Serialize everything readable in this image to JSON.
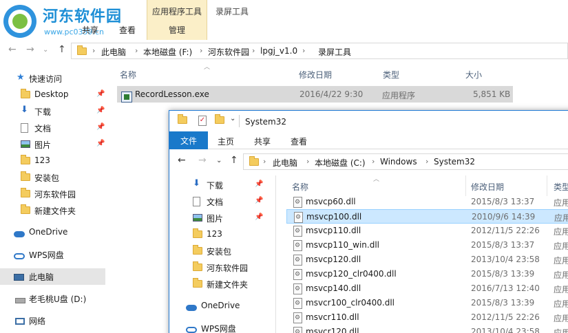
{
  "window1": {
    "watermark": {
      "brand": "河东软件园",
      "url": "www.pc0359.cn"
    },
    "context_tab_label": "应用程序工具",
    "context_subtab": "管理",
    "title": "录屏工具",
    "ribbon_tabs": [
      "共享",
      "查看"
    ],
    "breadcrumb": [
      "此电脑",
      "本地磁盘 (F:)",
      "河东软件园",
      "lpgj_v1.0",
      "录屏工具"
    ],
    "columns": [
      "名称",
      "修改日期",
      "类型",
      "大小"
    ],
    "nav": [
      {
        "label": "快速访问",
        "icon": "star-icon",
        "pinned": false
      },
      {
        "label": "Desktop",
        "icon": "folder-icon",
        "pinned": true
      },
      {
        "label": "下载",
        "icon": "download-icon",
        "pinned": true
      },
      {
        "label": "文档",
        "icon": "document-icon",
        "pinned": true
      },
      {
        "label": "图片",
        "icon": "picture-icon",
        "pinned": true
      },
      {
        "label": "123",
        "icon": "folder-icon",
        "pinned": false
      },
      {
        "label": "安装包",
        "icon": "folder-icon",
        "pinned": false
      },
      {
        "label": "河东软件园",
        "icon": "folder-icon",
        "pinned": false
      },
      {
        "label": "新建文件夹",
        "icon": "folder-icon",
        "pinned": false
      },
      {
        "label": "OneDrive",
        "icon": "onedrive-icon",
        "pinned": false
      },
      {
        "label": "WPS网盘",
        "icon": "wps-cloud-icon",
        "pinned": false
      },
      {
        "label": "此电脑",
        "icon": "this-pc-icon",
        "pinned": false,
        "selected": true
      },
      {
        "label": "老毛桃U盘 (D:)",
        "icon": "usb-drive-icon",
        "pinned": false
      },
      {
        "label": "网络",
        "icon": "network-icon",
        "pinned": false
      }
    ],
    "file": {
      "name": "RecordLesson.exe",
      "date": "2016/4/22 9:30",
      "type": "应用程序",
      "size": "5,851 KB"
    }
  },
  "window2": {
    "title": "System32",
    "ribbon_tabs": [
      "文件",
      "主页",
      "共享",
      "查看"
    ],
    "breadcrumb": [
      "此电脑",
      "本地磁盘 (C:)",
      "Windows",
      "System32"
    ],
    "columns": [
      "名称",
      "修改日期",
      "类型"
    ],
    "nav": [
      {
        "label": "下载",
        "icon": "download-icon",
        "pinned": true
      },
      {
        "label": "文档",
        "icon": "document-icon",
        "pinned": true
      },
      {
        "label": "图片",
        "icon": "picture-icon",
        "pinned": true
      },
      {
        "label": "123",
        "icon": "folder-icon",
        "pinned": false
      },
      {
        "label": "安装包",
        "icon": "folder-icon",
        "pinned": false
      },
      {
        "label": "河东软件园",
        "icon": "folder-icon",
        "pinned": false
      },
      {
        "label": "新建文件夹",
        "icon": "folder-icon",
        "pinned": false
      },
      {
        "label": "OneDrive",
        "icon": "onedrive-icon",
        "pinned": false
      },
      {
        "label": "WPS网盘",
        "icon": "wps-cloud-icon",
        "pinned": false
      }
    ],
    "files": [
      {
        "name": "msvcp60.dll",
        "date": "2015/8/3 13:37",
        "type": "应用"
      },
      {
        "name": "msvcp100.dll",
        "date": "2010/9/6 14:39",
        "type": "应用",
        "selected": true
      },
      {
        "name": "msvcp110.dll",
        "date": "2012/11/5 22:26",
        "type": "应用"
      },
      {
        "name": "msvcp110_win.dll",
        "date": "2015/8/3 13:37",
        "type": "应用"
      },
      {
        "name": "msvcp120.dll",
        "date": "2013/10/4 23:58",
        "type": "应用"
      },
      {
        "name": "msvcp120_clr0400.dll",
        "date": "2015/8/3 13:39",
        "type": "应用"
      },
      {
        "name": "msvcp140.dll",
        "date": "2016/7/13 12:40",
        "type": "应用"
      },
      {
        "name": "msvcr100_clr0400.dll",
        "date": "2015/8/3 13:39",
        "type": "应用"
      },
      {
        "name": "msvcr110.dll",
        "date": "2012/11/5 22:26",
        "type": "应用"
      },
      {
        "name": "msvcr120.dll",
        "date": "2013/10/4 23:58",
        "type": "应用"
      }
    ]
  }
}
